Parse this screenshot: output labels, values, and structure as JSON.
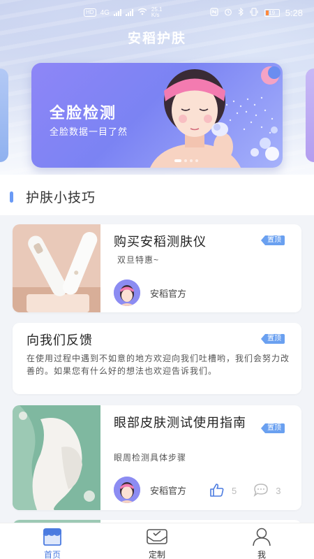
{
  "status_bar": {
    "network_badge": "HD",
    "network_type": "4G",
    "speed_value": "25.1",
    "speed_unit": "K/s",
    "battery": "19",
    "time": "5:28"
  },
  "app": {
    "title": "安稻护肤"
  },
  "banner": {
    "title": "全脸检测",
    "subtitle": "全脸数据一目了然",
    "slide_count": 4,
    "active_slide": 0
  },
  "section": {
    "title": "护肤小技巧"
  },
  "articles": [
    {
      "title": "购买安稻测肤仪",
      "subtitle": "双旦特惠~",
      "badge": "置顶",
      "author": "安稻官方"
    },
    {
      "title": "向我们反馈",
      "subtitle": "在使用过程中遇到不如意的地方欢迎向我们吐槽哟，我们会努力改善的。如果您有什么好的想法也欢迎告诉我们。",
      "badge": "置顶"
    },
    {
      "title": "眼部皮肤测试使用指南",
      "subtitle": "眼周检测具体步骤",
      "badge": "置顶",
      "author": "安稻官方",
      "likes": "5",
      "comments": "3"
    }
  ],
  "bottom_nav": [
    {
      "label": "首页",
      "icon": "home-icon",
      "active": true
    },
    {
      "label": "定制",
      "icon": "customize-icon",
      "active": false
    },
    {
      "label": "我",
      "icon": "profile-icon",
      "active": false
    }
  ],
  "colors": {
    "accent": "#4b7be0",
    "banner": "#8e86f7",
    "badge": "#6aa0f0"
  }
}
